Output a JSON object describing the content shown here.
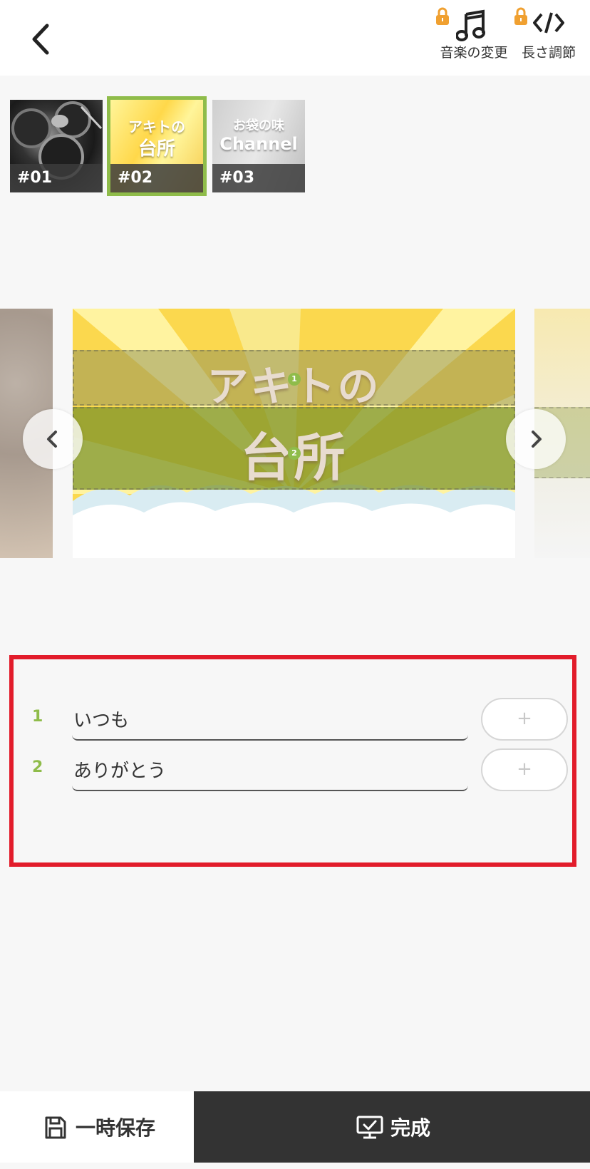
{
  "header": {
    "music_label": "音楽の変更",
    "length_label": "長さ調節"
  },
  "thumbnails": [
    {
      "label": "#01",
      "title": ""
    },
    {
      "label": "#02",
      "title_line1": "アキトの",
      "title_line2": "台所",
      "selected": true
    },
    {
      "label": "#03",
      "title_line1": "お袋の味",
      "title_line2": "Channel"
    }
  ],
  "preview": {
    "line1": "アキトの",
    "line2": "台所",
    "badge1": "1",
    "badge2": "2"
  },
  "editor": {
    "rows": [
      {
        "number": "1",
        "value": "いつも",
        "add_label": "+"
      },
      {
        "number": "2",
        "value": "ありがとう",
        "add_label": "+"
      }
    ]
  },
  "footer": {
    "save_label": "一時保存",
    "done_label": "完成"
  },
  "colors": {
    "accent_green": "#8fbc4a",
    "lock_orange": "#f0a030",
    "highlight_red": "#e21c2b",
    "dark_button": "#333333"
  }
}
